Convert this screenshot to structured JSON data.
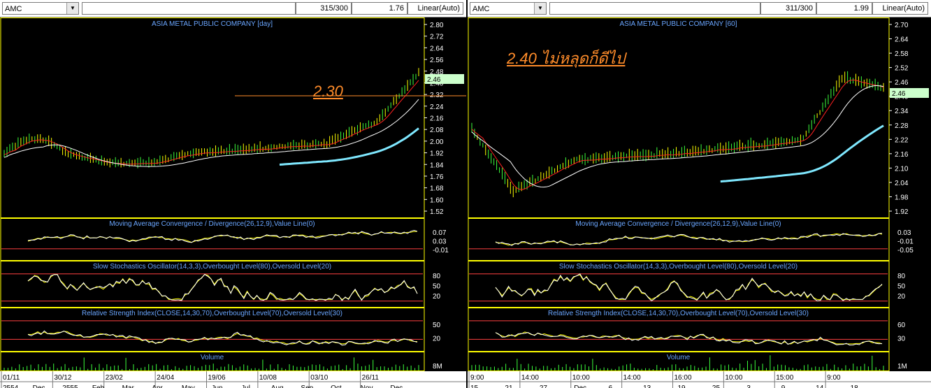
{
  "left": {
    "symbol": "AMC",
    "count": "315/300",
    "value": "1.76",
    "scale": "Linear(Auto)",
    "title": "ASIA METAL PUBLIC COMPANY [day]",
    "price_ticks": [
      "2.80",
      "2.72",
      "2.64",
      "2.56",
      "2.48",
      "2.40",
      "2.32",
      "2.24",
      "2.16",
      "2.08",
      "2.00",
      "1.92",
      "1.84",
      "1.76",
      "1.68",
      "1.60",
      "1.52"
    ],
    "last_price": "2.46",
    "annotation": "2.30",
    "macd_title": "Moving Average Convergence / Divergence(26,12,9),Value Line(0)",
    "macd_ticks": [
      "0.07",
      "0.03",
      "-0.01"
    ],
    "sto_title": "Slow Stochastics Oscillator(14,3,3),Overbought Level(80),Oversold Level(20)",
    "sto_ticks": [
      "80",
      "50",
      "20"
    ],
    "rsi_title": "Relative Strength Index(CLOSE,14,30,70),Overbought Level(70),Oversold Level(30)",
    "rsi_ticks": [
      "50",
      "20"
    ],
    "vol_title": "Volume",
    "vol_tick": "8M",
    "x_top": [
      "01/11",
      "30/12",
      "23/02",
      "24/04",
      "19/06",
      "10/08",
      "03/10",
      "26/11"
    ],
    "x_bottom": [
      "2554",
      "Dec",
      "2555",
      "Feb",
      "Mar",
      "Apr",
      "May",
      "Jun",
      "Jul",
      "Aug",
      "Sep",
      "Oct",
      "Nov",
      "Dec"
    ]
  },
  "right": {
    "symbol": "AMC",
    "count": "311/300",
    "value": "1.99",
    "scale": "Linear(Auto)",
    "title": "ASIA METAL PUBLIC COMPANY [60]",
    "price_ticks": [
      "2.70",
      "2.64",
      "2.58",
      "2.52",
      "2.46",
      "2.40",
      "2.34",
      "2.28",
      "2.22",
      "2.16",
      "2.10",
      "2.04",
      "1.98",
      "1.92"
    ],
    "last_price": "2.46",
    "annotation": "2.40 ไม่หลุดก็ดีไป",
    "macd_title": "Moving Average Convergence / Divergence(26,12,9),Value Line(0)",
    "macd_ticks": [
      "0.03",
      "-0.01",
      "-0.05"
    ],
    "sto_title": "Slow Stochastics Oscillator(14,3,3),Overbought Level(80),Oversold Level(20)",
    "sto_ticks": [
      "80",
      "50",
      "20"
    ],
    "rsi_title": "Relative Strength Index(CLOSE,14,30,70),Overbought Level(70),Oversold Level(30)",
    "rsi_ticks": [
      "60",
      "30"
    ],
    "vol_title": "Volume",
    "vol_tick": "1M",
    "x_top": [
      "9:00",
      "14:00",
      "10:00",
      "14:00",
      "16:00",
      "10:00",
      "15:00",
      "9:00"
    ],
    "x_bottom": [
      "15",
      "21",
      "27",
      "Dec",
      "6",
      "13",
      "19",
      "25",
      "3",
      "9",
      "14",
      "18"
    ]
  },
  "colors": {
    "bg": "#000000",
    "grid": "#ffff00",
    "title_blue": "#6aa6ff",
    "annotation_orange": "#ff8c2a",
    "last_price_bg": "#ccffcc",
    "ma_cyan": "#7fe8ff",
    "ma_white": "#ffffff",
    "ma_red": "#ff2020",
    "ma_yellow": "#ffff00"
  }
}
